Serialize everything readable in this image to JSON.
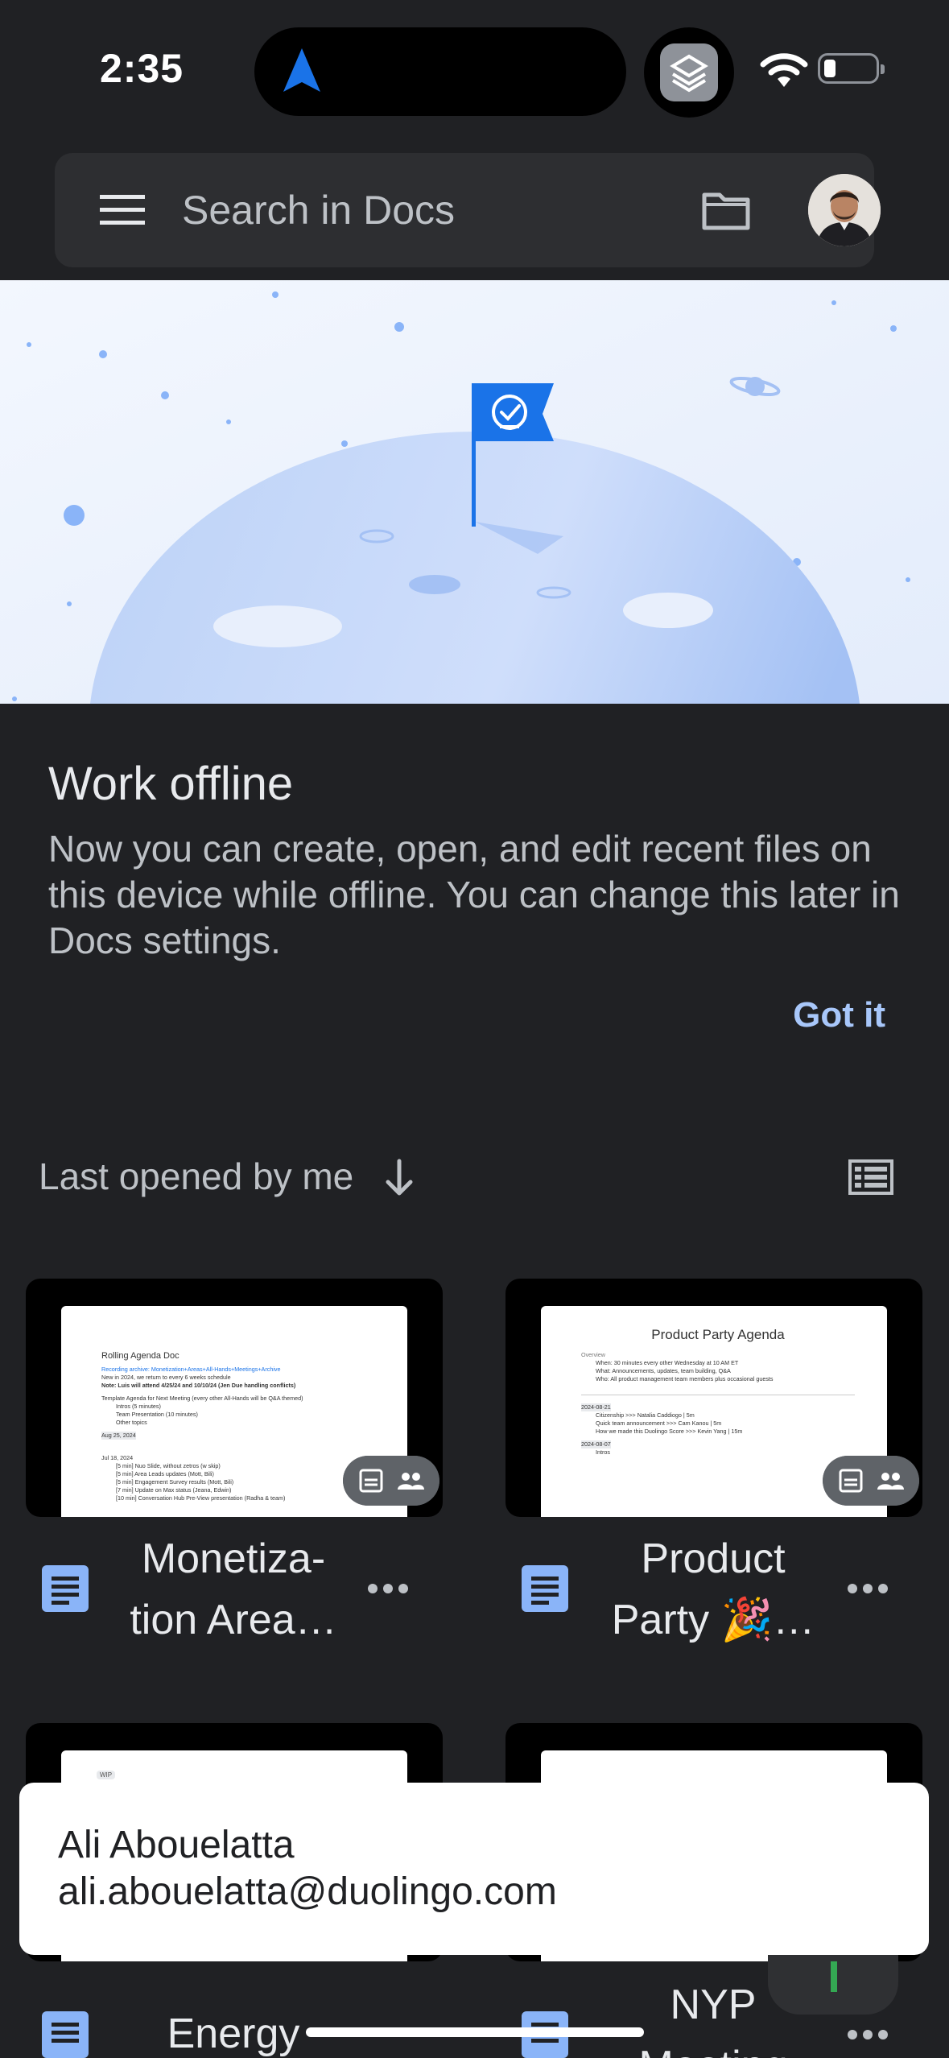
{
  "status_bar": {
    "time": "2:35"
  },
  "search": {
    "placeholder": "Search in Docs"
  },
  "offline_card": {
    "title": "Work offline",
    "body": "Now you can create, open, and edit recent files on this device while offline. You can change this later in Docs settings.",
    "dismiss_label": "Got it"
  },
  "sort": {
    "label": "Last opened by me"
  },
  "files": [
    {
      "name_line1": "Monetiza-",
      "name_line2": "tion Area…",
      "preview": {
        "heading": "Rolling Agenda Doc",
        "lines": [
          "Recording archive: Monetization+Areas+All-Hands+Meetings+Archive",
          "New in 2024, we return to every 6 weeks schedule",
          "Note: Luis will attend 4/25/24 and 10/10/24 (Jen Due handling conflicts)",
          "Template Agenda for Next Meeting (every other All-Hands will be Q&A themed)",
          "Intros (5 minutes)",
          "Team Presentation (10 minutes)",
          "Other topics",
          "Aug 25, 2024",
          "Jul 18, 2024",
          "[5 min] Nuo Slide, without zetros (w skip)",
          "[5 min] Area Leads updates (Mott, Bili)",
          "[5 min] Engagement Survey results (Mott, Bili)",
          "[7 min] Update on Max status (Jeana, Edwin)",
          "[10 min] Conversation Hub Pre-View presentation (Radha & team)"
        ]
      }
    },
    {
      "name_line1": "Product",
      "name_line2": "Party 🎉…",
      "preview": {
        "heading": "Product Party Agenda",
        "lines": [
          "Overview",
          "When: 30 minutes every other Wednesday at 10 AM ET",
          "What: Announcements, updates, team building, Q&A",
          "Who: All product management team members plus occasional guests",
          "2024-08-21",
          "Citizenship >>> Natalia Caddiogo | 5m",
          "Quick team announcement >>> Cam Kanou | 5m",
          "How we made this Duolingo Score >>> Kevin Yang | 15m",
          "2024-08-07",
          "Intros"
        ]
      }
    },
    {
      "name_line1": "Energy",
      "name_line2": "",
      "preview": {
        "heading": "WIP",
        "lines": []
      }
    },
    {
      "name_line1": "NYP",
      "name_line2": "Meeting",
      "preview": {
        "heading": "",
        "lines": []
      }
    }
  ],
  "toast": {
    "name": "Ali Abouelatta",
    "email": "ali.abouelatta@duolingo.com"
  },
  "colors": {
    "background": "#202124",
    "surface": "#2d2e31",
    "accent": "#a8c7fa",
    "doc_blue": "#8ab4f8"
  }
}
